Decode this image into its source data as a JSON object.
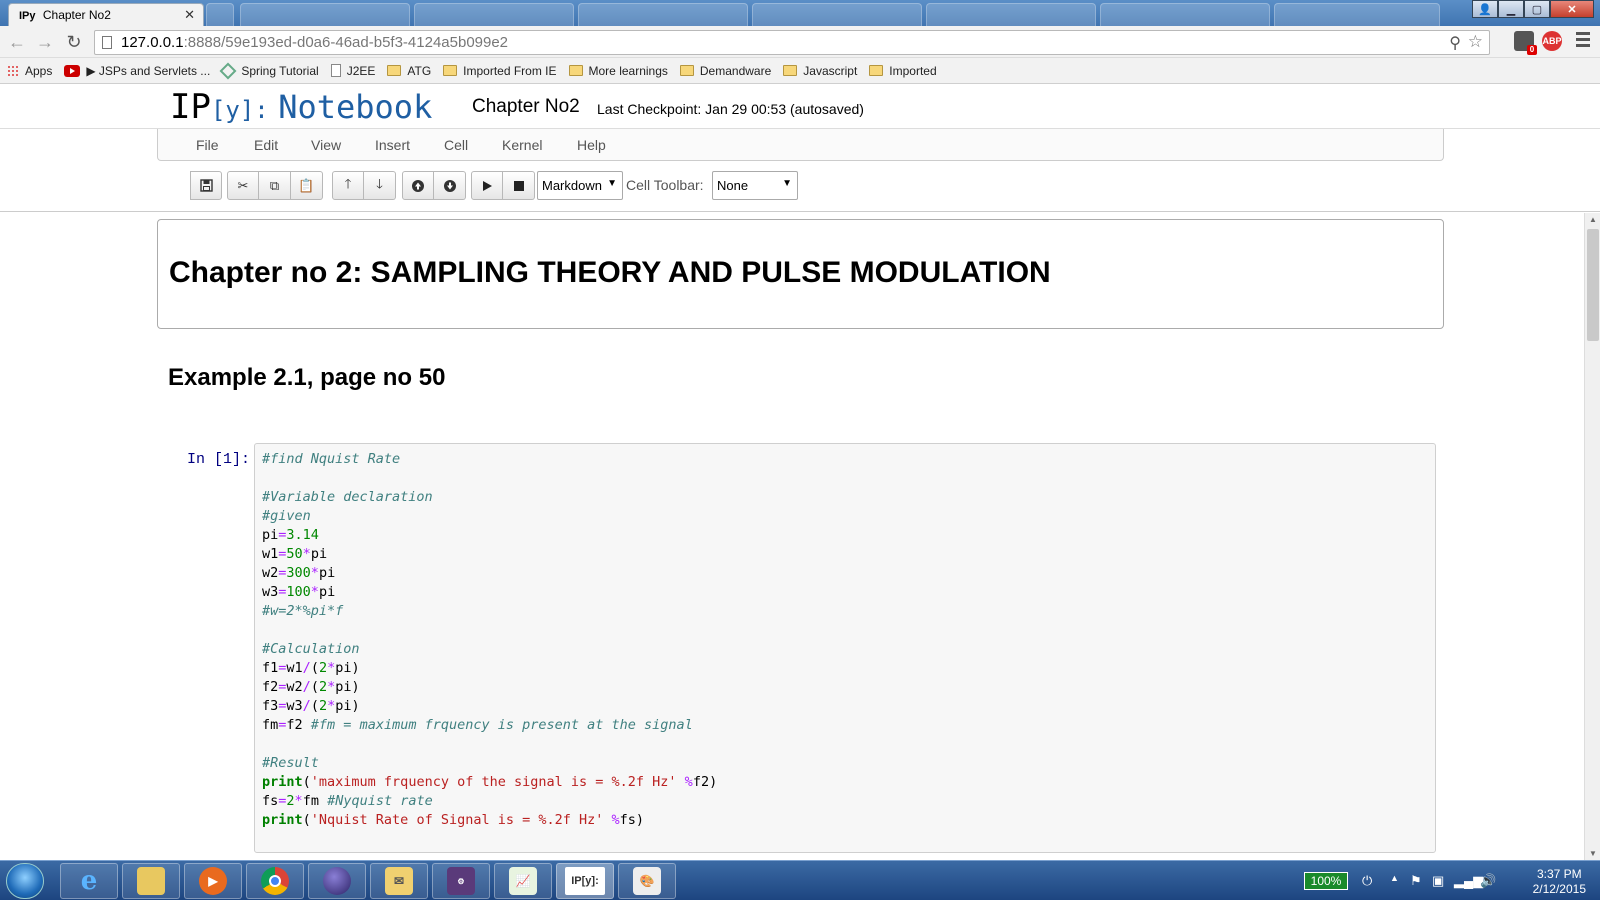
{
  "browser": {
    "active_tab_icon": "IPy",
    "active_tab_title": "Chapter No2",
    "url_host": "127.0.0.1",
    "url_rest": ":8888/59e193ed-d0a6-46ad-b5f3-4124a5b099e2",
    "ext_badge_count": "0",
    "abp_label": "ABP"
  },
  "bookmarks": [
    {
      "label": "Apps",
      "icon": "apps-grid"
    },
    {
      "label": "▶ JSPs and Servlets ...",
      "icon": "youtube"
    },
    {
      "label": "Spring Tutorial",
      "icon": "spring"
    },
    {
      "label": "J2EE",
      "icon": "doc"
    },
    {
      "label": "ATG",
      "icon": "folder"
    },
    {
      "label": "Imported From IE",
      "icon": "folder"
    },
    {
      "label": "More learnings",
      "icon": "folder"
    },
    {
      "label": "Demandware",
      "icon": "folder"
    },
    {
      "label": "Javascript",
      "icon": "folder"
    },
    {
      "label": "Imported",
      "icon": "folder"
    }
  ],
  "header": {
    "logo_ip": "IP",
    "logo_y": "[y]:",
    "logo_notebook": "Notebook",
    "notebook_name": "Chapter No2",
    "checkpoint": "Last Checkpoint: Jan 29 00:53 (autosaved)"
  },
  "menu": [
    "File",
    "Edit",
    "View",
    "Insert",
    "Cell",
    "Kernel",
    "Help"
  ],
  "toolbar": {
    "cell_type": "Markdown",
    "cell_toolbar_label": "Cell Toolbar:",
    "cell_toolbar_value": "None"
  },
  "cells": {
    "heading1": "Chapter no 2: SAMPLING THEORY AND PULSE MODULATION",
    "heading2": "Example 2.1, page no 50",
    "prompt": "In [1]:"
  },
  "taskbar": {
    "battery": "100%",
    "time": "3:37 PM",
    "date": "2/12/2015",
    "ipy_app_label": "IP[y]:"
  },
  "colors": {
    "ipython_blue": "#1f5fa3",
    "comment": "#408080",
    "number": "#008800",
    "keyword": "#008000",
    "string": "#ba2121",
    "operator": "#aa22ff"
  }
}
